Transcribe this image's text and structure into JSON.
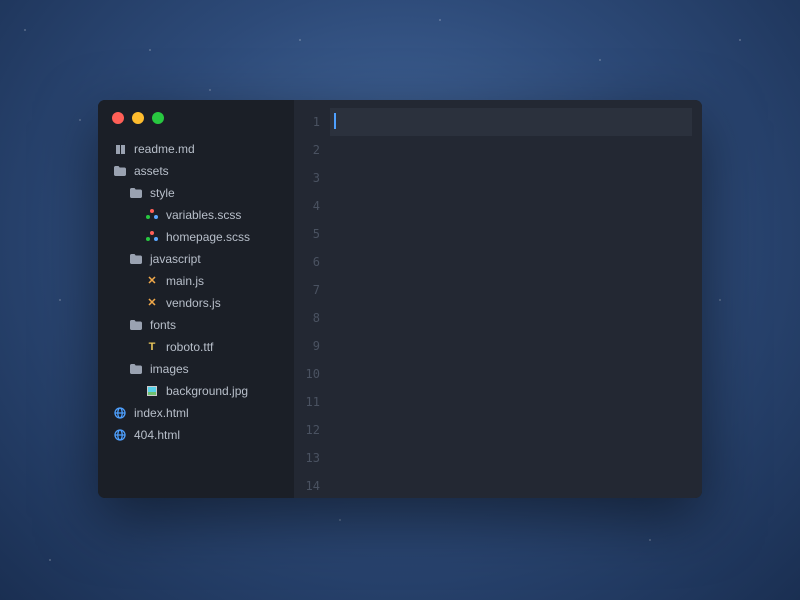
{
  "sidebar": {
    "tree": [
      {
        "type": "file",
        "icon": "md",
        "label": "readme.md",
        "indent": 0
      },
      {
        "type": "folder",
        "icon": "folder",
        "label": "assets",
        "indent": 0
      },
      {
        "type": "folder",
        "icon": "folder",
        "label": "style",
        "indent": 1
      },
      {
        "type": "file",
        "icon": "scss",
        "label": "variables.scss",
        "indent": 2
      },
      {
        "type": "file",
        "icon": "scss",
        "label": "homepage.scss",
        "indent": 2
      },
      {
        "type": "folder",
        "icon": "folder",
        "label": "javascript",
        "indent": 1
      },
      {
        "type": "file",
        "icon": "js",
        "label": "main.js",
        "indent": 2
      },
      {
        "type": "file",
        "icon": "js",
        "label": "vendors.js",
        "indent": 2
      },
      {
        "type": "folder",
        "icon": "folder",
        "label": "fonts",
        "indent": 1
      },
      {
        "type": "file",
        "icon": "ttf",
        "label": "roboto.ttf",
        "indent": 2
      },
      {
        "type": "folder",
        "icon": "folder",
        "label": "images",
        "indent": 1
      },
      {
        "type": "file",
        "icon": "img",
        "label": "background.jpg",
        "indent": 2
      },
      {
        "type": "file",
        "icon": "html",
        "label": "index.html",
        "indent": 0
      },
      {
        "type": "file",
        "icon": "html",
        "label": "404.html",
        "indent": 0
      }
    ]
  },
  "editor": {
    "line_numbers": [
      "1",
      "2",
      "3",
      "4",
      "5",
      "6",
      "7",
      "8",
      "9",
      "10",
      "11",
      "12",
      "13",
      "14"
    ],
    "active_line": 1
  },
  "colors": {
    "sidebar_bg": "#1b1f27",
    "editor_bg": "#232833",
    "accent": "#4ea0ff"
  }
}
